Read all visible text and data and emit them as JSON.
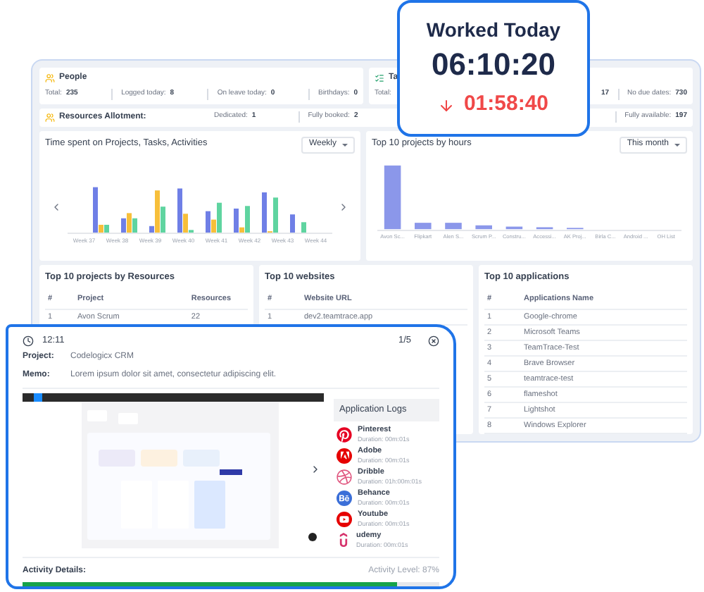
{
  "people": {
    "title": "People",
    "stats": [
      {
        "label": "Total:",
        "value": "235"
      },
      {
        "label": "Logged today:",
        "value": "8"
      },
      {
        "label": "On leave today:",
        "value": "0"
      },
      {
        "label": "Birthdays:",
        "value": "0"
      }
    ]
  },
  "tasks": {
    "title": "Ta",
    "left_stats": [
      {
        "label": "Total:"
      }
    ],
    "right_stats": [
      {
        "value": "17"
      },
      {
        "label": "No due dates:",
        "value": "730"
      }
    ]
  },
  "resources": {
    "title": "Resources Allotment:",
    "stats": [
      {
        "label": "Dedicated:",
        "value": "1"
      },
      {
        "label": "Fully booked:",
        "value": "2"
      }
    ],
    "right_stats": [
      {
        "label": "Fully available:",
        "value": "197"
      }
    ]
  },
  "time_chart": {
    "title": "Time spent on Projects, Tasks, Activities",
    "period": "Weekly",
    "weeks": [
      "Week 37",
      "Week 38",
      "Week 39",
      "Week 40",
      "Week 41",
      "Week 42",
      "Week 43",
      "Week 44"
    ]
  },
  "hours_chart": {
    "title": "Top 10 projects by hours",
    "period": "This month",
    "projects": [
      "Avon Sc...",
      "Flipkart",
      "Alen S...",
      "Scrum P...",
      "Constru...",
      "Accessi...",
      "AK Proj...",
      "Birla C...",
      "Android ...",
      "OH List"
    ]
  },
  "resources_table": {
    "title": "Top 10 projects by Resources",
    "columns": [
      "#",
      "Project",
      "Resources"
    ],
    "rows": [
      [
        "1",
        "Avon Scrum",
        "22"
      ]
    ]
  },
  "websites_table": {
    "title": "Top 10 websites",
    "columns": [
      "#",
      "Website URL"
    ],
    "rows": [
      [
        "1",
        "dev2.teamtrace.app"
      ]
    ]
  },
  "apps_table": {
    "title": "Top 10 applications",
    "columns": [
      "#",
      "Applications Name"
    ],
    "rows": [
      [
        "1",
        "Google-chrome"
      ],
      [
        "2",
        "Microsoft Teams"
      ],
      [
        "3",
        "TeamTrace-Test"
      ],
      [
        "4",
        "Brave Browser"
      ],
      [
        "5",
        "teamtrace-test"
      ],
      [
        "6",
        "flameshot"
      ],
      [
        "7",
        "Lightshot"
      ],
      [
        "8",
        "Windows Explorer"
      ]
    ]
  },
  "worked_today": {
    "title": "Worked Today",
    "time": "06:10:20",
    "deficit": "01:58:40"
  },
  "activity": {
    "time": "12:11",
    "page": "1/5",
    "project_label": "Project:",
    "project": "Codelogicx CRM",
    "memo_label": "Memo:",
    "memo": "Lorem ipsum dolor sit amet, consectetur adipiscing elit.",
    "logs_title": "Application Logs",
    "logs": [
      {
        "kind": "pinterest",
        "name": "Pinterest",
        "duration": "Duration: 00m:01s"
      },
      {
        "kind": "adobe",
        "name": "Adobe",
        "duration": "Duration: 00m:01s"
      },
      {
        "kind": "dribbble",
        "name": "Dribble",
        "duration": "Duration: 01h:00m:01s"
      },
      {
        "kind": "behance",
        "name": "Behance",
        "duration": "Duration: 00m:01s"
      },
      {
        "kind": "youtube",
        "name": "Youtube",
        "duration": "Duration: 00m:01s"
      },
      {
        "kind": "udemy",
        "name": "udemy",
        "duration": "Duration: 00m:01s"
      }
    ],
    "details_label": "Activity Details:",
    "level_label": "Activity Level: 87%",
    "level": 0.9
  }
}
